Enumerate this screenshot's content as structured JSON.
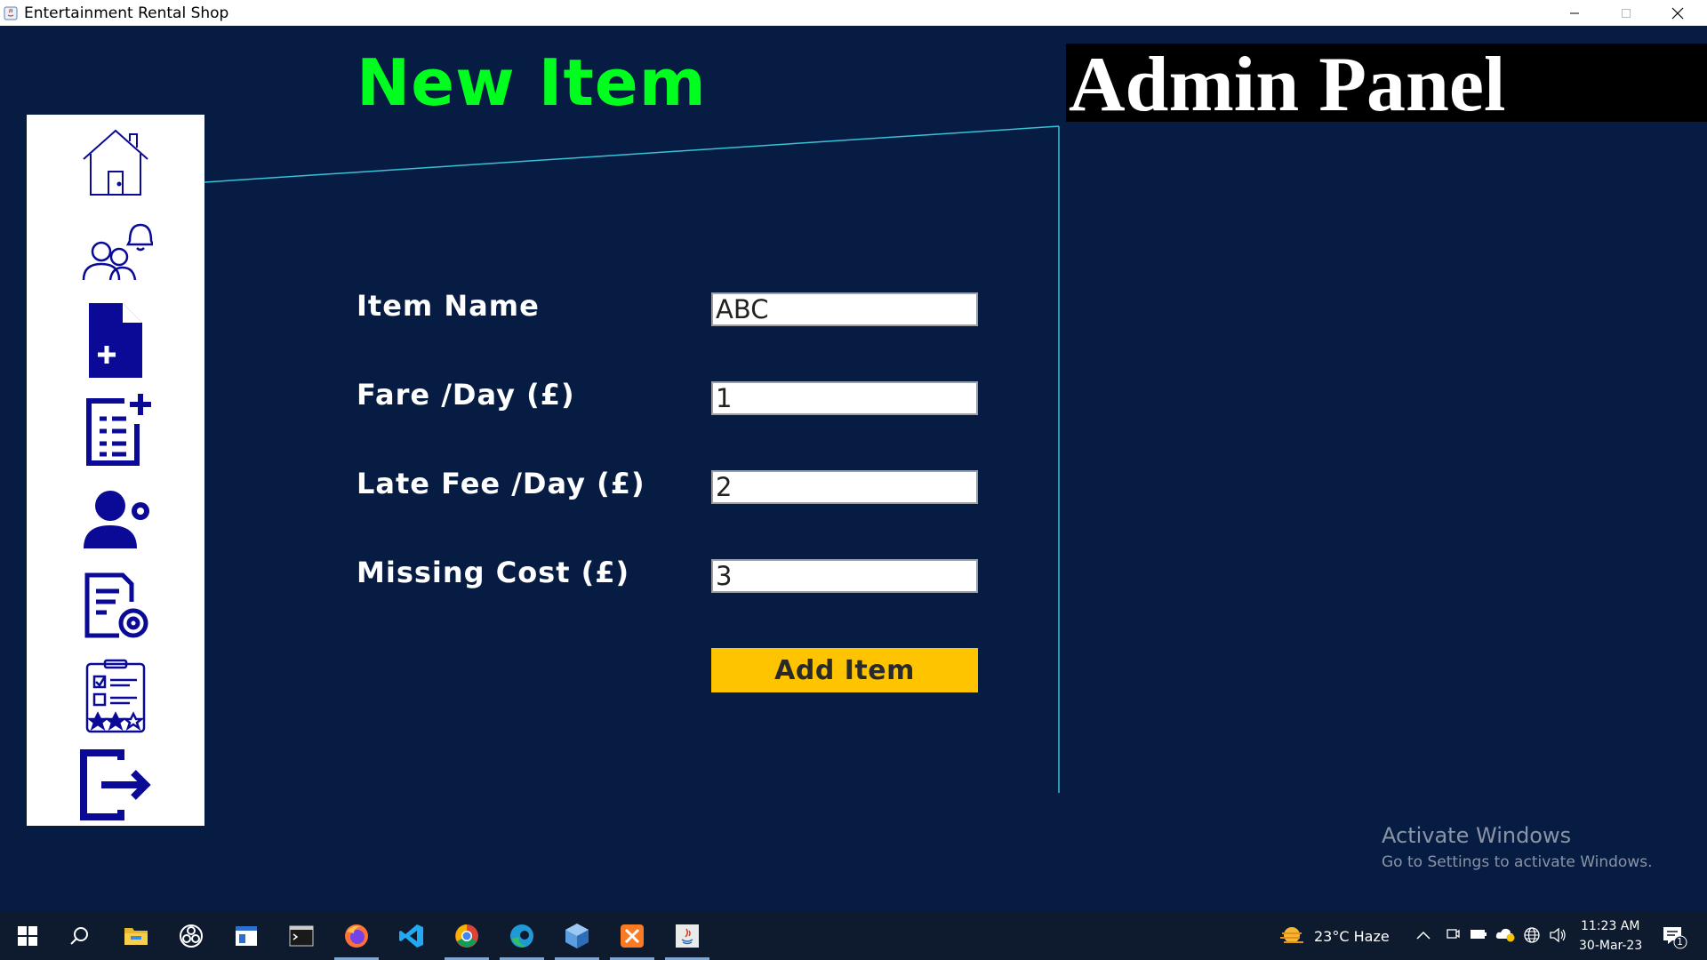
{
  "window": {
    "title": "Entertainment Rental Shop",
    "controls": [
      "minimize-icon",
      "restore-icon",
      "close-icon"
    ]
  },
  "header": {
    "page_title": "New Item",
    "admin_panel": "Admin Panel"
  },
  "sidebar": {
    "items": [
      {
        "icon": "home-icon"
      },
      {
        "icon": "users-notification-icon"
      },
      {
        "icon": "new-document-icon"
      },
      {
        "icon": "add-list-icon"
      },
      {
        "icon": "user-settings-icon"
      },
      {
        "icon": "document-settings-icon"
      },
      {
        "icon": "checklist-rating-icon"
      },
      {
        "icon": "logout-icon"
      }
    ]
  },
  "form": {
    "item_name": {
      "label": "Item Name",
      "value": "ABC"
    },
    "fare": {
      "label": "Fare /Day (£)",
      "value": "1"
    },
    "late_fee": {
      "label": "Late Fee /Day (£)",
      "value": "2"
    },
    "missing_cost": {
      "label": "Missing Cost (£)",
      "value": "3"
    },
    "submit_label": "Add Item"
  },
  "watermark": {
    "line1": "Activate Windows",
    "line2": "Go to Settings to activate Windows."
  },
  "taskbar": {
    "apps": [
      "windows-start-icon",
      "search-icon",
      "file-explorer-icon",
      "obs-icon",
      "app-window-icon",
      "terminal-icon",
      "firefox-icon",
      "vscode-icon",
      "chrome-icon",
      "edge-icon",
      "virtualbox-icon",
      "xampp-icon",
      "java-icon"
    ],
    "weather": "23°C  Haze",
    "time": "11:23 AM",
    "date": "30-Mar-23",
    "notification_count": "1"
  },
  "colors": {
    "background": "#061c42",
    "title_green": "#00ff1e",
    "button_yellow": "#ffc400",
    "icon_blue": "#0a0a96",
    "line_cyan": "#37c3d8"
  }
}
